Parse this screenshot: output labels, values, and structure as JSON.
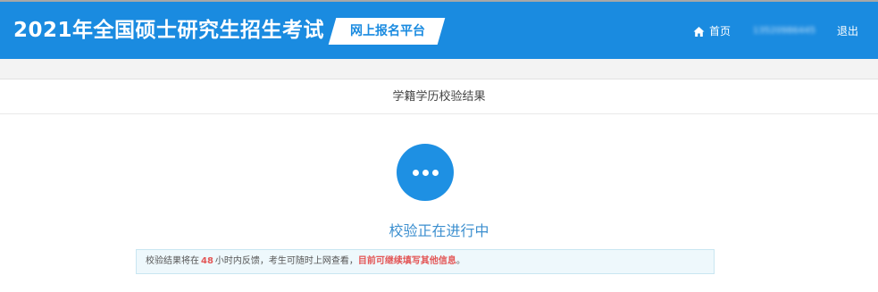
{
  "header": {
    "site_title": "2021年全国硕士研究生招生考试",
    "platform_label": "网上报名平台",
    "nav": {
      "home_label": "首页",
      "user_account": "13520986445",
      "logout_label": "退出"
    }
  },
  "panel": {
    "title": "学籍学历校验结果",
    "status_text": "校验正在进行中",
    "notice": {
      "text_before": "校验结果将在",
      "hours": "48",
      "text_after": "小时内反馈，考生可随时上网查看，",
      "highlight": "目前可继续填写其他信息",
      "end": "。"
    }
  },
  "colors": {
    "header_blue": "#1a8be0",
    "status_blue": "#1e90e3",
    "notice_red": "#e35656",
    "notice_bg": "#eef8fc"
  },
  "icons": {
    "home": "home-icon",
    "status": "more-dots-icon"
  }
}
